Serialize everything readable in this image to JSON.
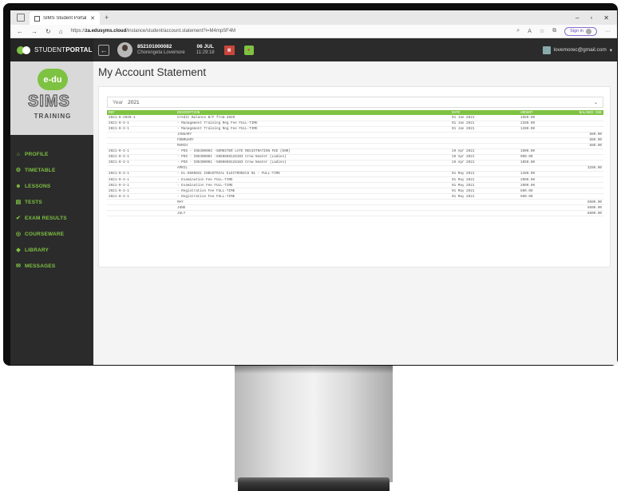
{
  "browser": {
    "tab_title": "SIMS Student Portal - ET",
    "url_prefix": "https://",
    "url_host": "za.edusyms.cloud",
    "url_path": "/instance/student/account.statement?i=M4mpSF4M",
    "signin_label": "Sign in"
  },
  "brand": {
    "name_light": "STUDENT",
    "name_bold": "PORTAL"
  },
  "logo": {
    "badge": "e-du",
    "word": "SIMS",
    "tagline": "TRAINING"
  },
  "menu": [
    {
      "label": "PROFILE",
      "icon": "home-icon",
      "glyph": "⌂"
    },
    {
      "label": "TIMETABLE",
      "icon": "gear-icon",
      "glyph": "⚙"
    },
    {
      "label": "LESSONS",
      "icon": "users-icon",
      "glyph": "☻"
    },
    {
      "label": "TESTS",
      "icon": "list-icon",
      "glyph": "▤"
    },
    {
      "label": "EXAM RESULTS",
      "icon": "check-icon",
      "glyph": "✔"
    },
    {
      "label": "COURSEWARE",
      "icon": "globe-icon",
      "glyph": "◎"
    },
    {
      "label": "LIBRARY",
      "icon": "book-icon",
      "glyph": "◆"
    },
    {
      "label": "MESSAGES",
      "icon": "message-icon",
      "glyph": "✉"
    }
  ],
  "appbar": {
    "student_id": "852101000082",
    "student_name": "Chorengeta Lovemore",
    "date": "06 JUL",
    "time": "11:29:18",
    "email": "lovemorec@gmail.com"
  },
  "page": {
    "title": "My Account Statement"
  },
  "filter": {
    "label": "Year",
    "value": "2021"
  },
  "table": {
    "headers": [
      "REF",
      "DESCRIPTION",
      "DATE",
      "AMOUNT",
      "BALANCE DUE"
    ],
    "rows": [
      [
        "2021-0-2020-1",
        "        Credit Balance B/F from 2020",
        "01 Jan 2021",
        "1650.00",
        ""
      ],
      [
        "2021-0-3-1",
        "- Management Training Reg Fee FULL-TIME",
        "01 Jan 2021",
        "2280.00",
        ""
      ],
      [
        "2021-0-3-1",
        "- Management Training Reg Fee FULL-TIME",
        "01 Jan 2021",
        "1280.00",
        ""
      ],
      [
        "",
        "JANUARY",
        "",
        "",
        "880.00"
      ],
      [
        "",
        "FEBRUARY",
        "",
        "",
        "880.00"
      ],
      [
        "",
        "MARCH",
        "",
        "",
        "880.00"
      ],
      [
        "2021-0-3-1",
        "- POS - IN5300003 -SEMESTER LATE REGISTRATION FEE (ENR)",
        "19 Apr 2021",
        "1000.00",
        ""
      ],
      [
        "2021-0-3-1",
        "- POS - IN5300001 -5080808128103 Crew Neater (Ladies)",
        "19 Apr 2021",
        "900.00",
        ""
      ],
      [
        "2021-0-3-1",
        "- POS - IN5300001 -5080808128103 Crew Neater (Ladies)",
        "19 Apr 2021",
        "1050.00",
        ""
      ],
      [
        "",
        "APRIL",
        "",
        "",
        "3280.00"
      ],
      [
        "2021-0-3-1",
        "- EL-0608041 INDUSTRIAL ELECTRONICS N1 - FULL-TIME",
        "01 May 2021",
        "1280.00",
        ""
      ],
      [
        "2021-0-3-1",
        "- Examination Fee FULL-TIME",
        "01 May 2021",
        "2000.00",
        ""
      ],
      [
        "2021-0-3-1",
        "- Examination Fee FULL-TIME",
        "01 May 2021",
        "2000.00",
        ""
      ],
      [
        "2021-0-3-1",
        "- Registration Fee FULL-TIME",
        "01 May 2021",
        "800.00",
        ""
      ],
      [
        "2021-0-3-1",
        "- Registration Fee FULL-TIME",
        "01 May 2021",
        "500.00",
        ""
      ],
      [
        "",
        "MAY",
        "",
        "",
        "8800.00"
      ],
      [
        "",
        "JUNE",
        "",
        "",
        "8800.00"
      ],
      [
        "",
        "JULY",
        "",
        "",
        "8800.00"
      ]
    ]
  },
  "colors": {
    "accent": "#7ec242",
    "sidebar": "#2b2b2b",
    "bezel": "#0d0d0d"
  }
}
